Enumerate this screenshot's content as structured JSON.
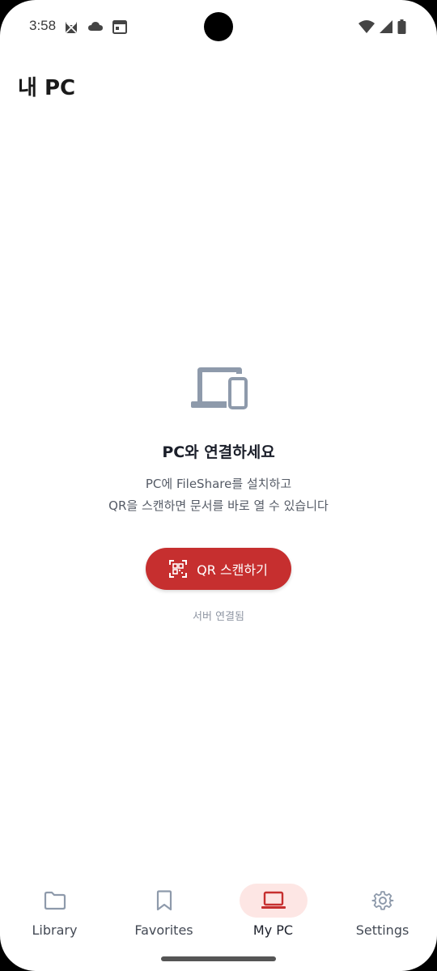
{
  "status_bar": {
    "time": "3:58",
    "left_icons": [
      "cat-notification-icon",
      "cloud-icon",
      "calendar-icon"
    ],
    "right_icons": [
      "wifi-icon",
      "signal-icon",
      "battery-icon"
    ]
  },
  "header": {
    "title": "내 PC"
  },
  "empty_state": {
    "icon": "laptop-phone-icon",
    "heading": "PC와 연결하세요",
    "desc_line1": "PC에 FileShare를 설치하고",
    "desc_line2": "QR을 스캔하면 문서를 바로 열 수 있습니다",
    "qr_button_label": "QR 스캔하기",
    "server_status": "서버 연결됨"
  },
  "bottom_nav": {
    "items": [
      {
        "label": "Library",
        "icon": "folder-icon",
        "active": false
      },
      {
        "label": "Favorites",
        "icon": "bookmark-icon",
        "active": false
      },
      {
        "label": "My PC",
        "icon": "laptop-icon",
        "active": true
      },
      {
        "label": "Settings",
        "icon": "gear-icon",
        "active": false
      }
    ]
  },
  "colors": {
    "accent": "#c62f2f",
    "active_pill": "#fde6e4",
    "icon_gray": "#8e9aab"
  }
}
